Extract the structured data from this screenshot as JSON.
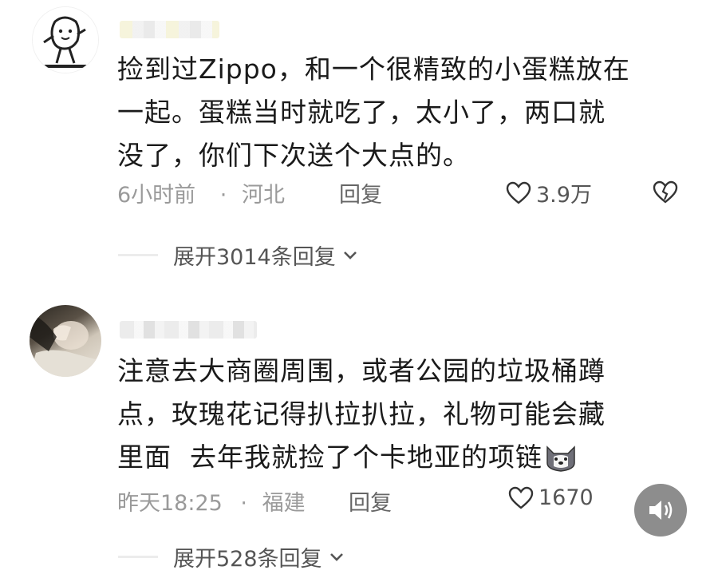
{
  "comments": [
    {
      "text": "捡到过Zippo，和一个很精致的小蛋糕放在\n一起。蛋糕当时就吃了，太小了，两口就\n没了，你们下次送个大点的。",
      "time": "6小时前",
      "separator": "·",
      "location": "河北",
      "reply_label": "回复",
      "likes": "3.9万",
      "expand_label": "展开3014条回复"
    },
    {
      "text": "注意去大商圈周围，或者公园的垃圾桶蹲\n点，玫瑰花记得扒拉扒拉，礼物可能会藏\n里面  去年我就捡了个卡地亚的项链",
      "time": "昨天18:25",
      "separator": "·",
      "location": "福建",
      "reply_label": "回复",
      "likes": "1670",
      "expand_label": "展开528条回复"
    }
  ],
  "icons": {
    "like": "heart-outline-icon",
    "dislike": "broken-heart-icon",
    "expand": "chevron-down-icon",
    "sound": "speaker-icon"
  }
}
